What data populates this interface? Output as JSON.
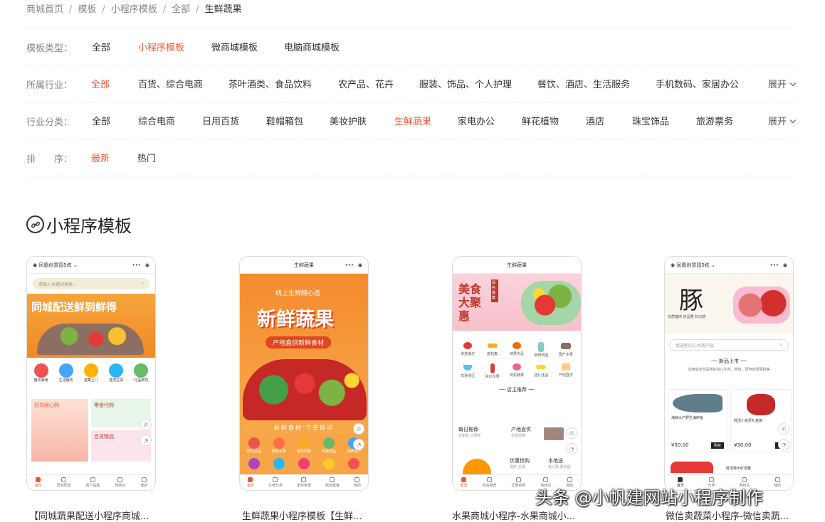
{
  "breadcrumb": [
    "商城首页",
    "模板",
    "小程序模板",
    "全部",
    "生鲜蔬果"
  ],
  "filters": {
    "template_type": {
      "label": "模板类型：",
      "options": [
        "全部",
        "小程序模板",
        "微商城模板",
        "电脑商城模板"
      ],
      "active": 1
    },
    "industry": {
      "label": "所属行业：",
      "options": [
        "全部",
        "百货、综合电商",
        "茶叶酒类、食品饮料",
        "农产品、花卉",
        "服装、饰品、个人护理",
        "餐饮、酒店、生活服务",
        "手机数码、家居办公"
      ],
      "active": 0,
      "expand": "展开"
    },
    "category": {
      "label": "行业分类：",
      "options": [
        "全部",
        "综合电商",
        "日用百货",
        "鞋帽箱包",
        "美妆护肤",
        "生鲜蔬果",
        "家电办公",
        "鲜花植物",
        "酒店",
        "珠宝饰品",
        "旅游票务"
      ],
      "active": 5,
      "expand": "展开"
    },
    "sort": {
      "label": "排　　序：",
      "options": [
        "最新",
        "热门"
      ],
      "active": 0
    }
  },
  "section": {
    "title": "小程序模板",
    "icon": "link-icon"
  },
  "templates": [
    {
      "caption": "【同城蔬果配送小程序商城...",
      "top_title": "凤凰创意园5栋",
      "search_placeholder": "请输入关键词搜索...",
      "banner_text": "同城配送鲜到鲜得",
      "icons": [
        "餐饮美食",
        "生活服务",
        "送菜上门",
        "送洗拉货",
        "礼品鲜花"
      ],
      "promo": [
        "好货限心购",
        "零食代购",
        "百货精品"
      ],
      "tabs": [
        "首页",
        "同城配送",
        "商户品集",
        "购物车",
        "我的"
      ]
    },
    {
      "caption": "生鲜蔬果小程序模板【生鲜...",
      "top_title": "生鲜蔬果",
      "banner_small": "线上生鲜随心选",
      "banner_text": "新鲜蔬果",
      "banner_sub": "产地直供新鲜食材",
      "banner_footer": "新鲜食材·下单即送",
      "icons": [
        "新鲜豆品",
        "新鲜水果",
        "餐饮熟食",
        "肉禽蛋品",
        "海鲜水产"
      ],
      "tabs": [
        "首页",
        "生鲜分类",
        "家常菜谱",
        "组合套餐",
        "我的"
      ]
    },
    {
      "caption": "水果商城小程序-水果商城小...",
      "top_title": "生鲜蔬果",
      "banner_text": "美食大聚惠",
      "banner_side": "绿色健康",
      "grid": [
        "本地速达",
        "面包集",
        "鲜果先品",
        "新鲜肉蛋",
        "国产水果",
        "优惠专区",
        "进口水果",
        "有机蔬果",
        "送礼佳品",
        "产地直供"
      ],
      "recommend_title": "店主推荐",
      "rec": [
        {
          "title": "每日推荐",
          "sub": "日新鲜 日更新"
        },
        {
          "title": "产地直供",
          "sub": "农场现摘"
        },
        {
          "title": "优惠抢购",
          "sub": "限时 全场"
        },
        {
          "title": "本地送",
          "sub": "安心购 限时送"
        }
      ],
      "tabs": [
        "首页",
        "新品推荐",
        "优惠抢购",
        "购物车",
        "我的"
      ]
    },
    {
      "caption": "微信卖蔬菜小程序-微信卖蔬...",
      "top_title": "凤凰创意园5栋",
      "banner_text": "豚",
      "banner_sub": "优质猪肉 好品质 好口感",
      "search_placeholder": "挑选你的心水商产品",
      "new_title": "新品上市",
      "new_sub": "选用高安全品牌的进口牛肉，新鲜，原骨肉质更鲜美",
      "products": [
        {
          "name": "海鲜水产野生海鲈鱼",
          "price": "¥50.00",
          "btn": "购买"
        },
        {
          "name": "鲜活小龙虾礼盒装",
          "price": "¥30.00",
          "btn": "购买"
        }
      ],
      "footer_item": "鲜活特大红膏蟹",
      "tabs": [
        "首页",
        "分类",
        "购物车",
        "我的"
      ]
    }
  ],
  "watermark": "头条 @小帆建网站小程序制作",
  "colors": {
    "accent": "#e8593b",
    "muted": "#888888",
    "rule": "#e6e6e6"
  }
}
